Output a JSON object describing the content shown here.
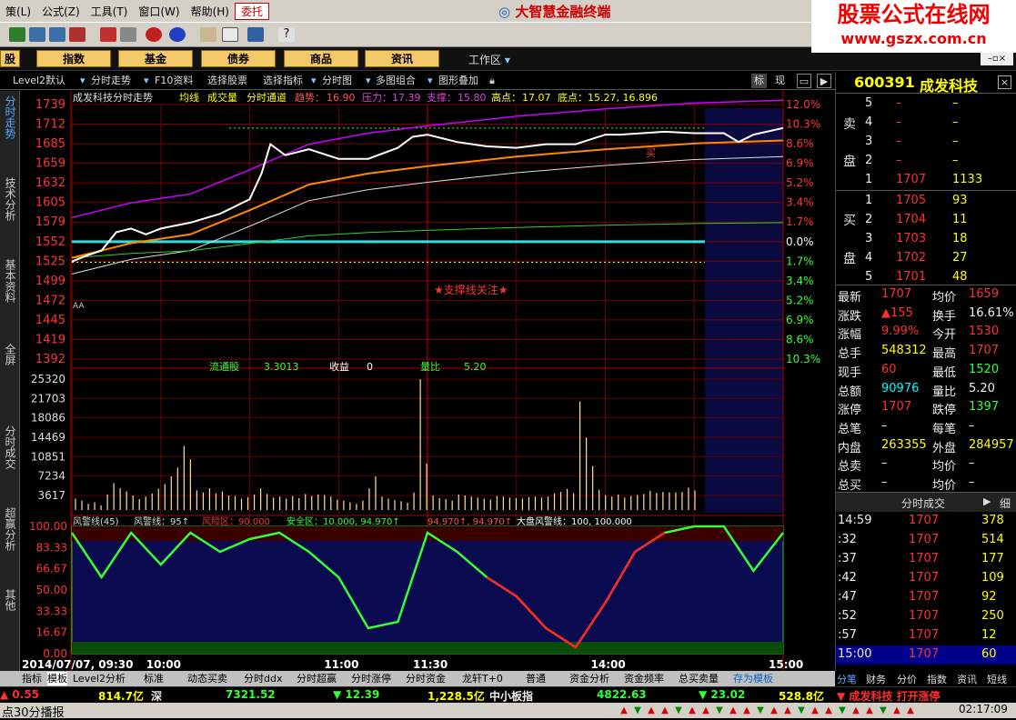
{
  "menu": {
    "items": [
      "策(L)",
      "公式(Z)",
      "工具(T)",
      "窗口(W)",
      "帮助(H)",
      "委托"
    ],
    "brand": "大智慧金融终端"
  },
  "watermark": {
    "line1": "股票公式在线网",
    "line2": "www.gszx.com.cn"
  },
  "nav": {
    "b0": "股",
    "b1": "指数",
    "b2": "基金",
    "b3": "债券",
    "b4": "商品",
    "b5": "资讯",
    "workarea": "工作区"
  },
  "tabs": {
    "t1": "Level2默认",
    "t2": "分时走势",
    "t3": "F10资料",
    "t4": "选择股票",
    "t5": "选择指标",
    "t6": "分时图",
    "t7": "多图组合",
    "t8": "图形叠加",
    "t9": "标",
    "t10": "现"
  },
  "sidebar": [
    "分时走势",
    "技术分析",
    "基本资料",
    "全屏",
    "分时成交",
    "超赢分析",
    "其他"
  ],
  "chart_header": {
    "name": "成发科技分时走势",
    "avg": "均线",
    "vol": "成交量",
    "channel": "分时通道",
    "trend_l": "趋势：",
    "trend_v": "16.90",
    "press_l": "压力：",
    "press_v": "17.39",
    "sup_l": "支撑：",
    "sup_v": "15.80",
    "high_l": "高点：",
    "high_v": "17.07",
    "low_l": "底点：",
    "low_v": "15.27, 16.896"
  },
  "chart_data": {
    "type": "line",
    "title": "成发科技分时走势",
    "prev_close": 15.52,
    "price_ticks": [
      "1739",
      "1712",
      "1685",
      "1659",
      "1632",
      "1605",
      "1579",
      "1552",
      "1525",
      "1499",
      "1472",
      "1445",
      "1419",
      "1392"
    ],
    "pct_ticks": [
      "12.0%",
      "10.3%",
      "8.6%",
      "6.9%",
      "5.2%",
      "3.4%",
      "1.7%",
      "0.0%",
      "1.7%",
      "3.4%",
      "5.2%",
      "6.9%",
      "8.6%",
      "10.3%"
    ],
    "vol_ticks": [
      "25320",
      "21703",
      "18086",
      "14469",
      "10851",
      "7234",
      "3617"
    ],
    "warn_ticks": [
      "100.00",
      "83.33",
      "66.67",
      "50.00",
      "33.33",
      "16.67",
      "0.00"
    ],
    "time_labels": [
      "2014/07/07, 09:30",
      "10:00",
      "11:00",
      "11:30",
      "14:00",
      "15:00"
    ],
    "price_series": [
      [
        0,
        15.25
      ],
      [
        5,
        15.33
      ],
      [
        10,
        15.4
      ],
      [
        15,
        15.65
      ],
      [
        20,
        15.7
      ],
      [
        25,
        15.62
      ],
      [
        30,
        15.7
      ],
      [
        40,
        15.78
      ],
      [
        50,
        15.9
      ],
      [
        60,
        16.1
      ],
      [
        64,
        16.45
      ],
      [
        67,
        16.85
      ],
      [
        72,
        16.7
      ],
      [
        80,
        16.78
      ],
      [
        90,
        16.65
      ],
      [
        100,
        16.65
      ],
      [
        110,
        16.8
      ],
      [
        115,
        16.95
      ],
      [
        120,
        16.98
      ],
      [
        130,
        16.88
      ],
      [
        140,
        16.82
      ],
      [
        150,
        16.8
      ],
      [
        160,
        16.85
      ],
      [
        170,
        16.85
      ],
      [
        180,
        16.98
      ],
      [
        185,
        16.98
      ],
      [
        200,
        17.02
      ],
      [
        210,
        17.0
      ],
      [
        220,
        17.0
      ],
      [
        225,
        16.88
      ],
      [
        230,
        16.98
      ],
      [
        240,
        17.07
      ]
    ],
    "avg_series": [
      [
        0,
        15.3
      ],
      [
        20,
        15.5
      ],
      [
        40,
        15.62
      ],
      [
        60,
        15.95
      ],
      [
        80,
        16.3
      ],
      [
        100,
        16.45
      ],
      [
        120,
        16.55
      ],
      [
        150,
        16.68
      ],
      [
        180,
        16.78
      ],
      [
        210,
        16.86
      ],
      [
        240,
        16.9
      ]
    ],
    "volumes": [
      2200,
      1800,
      1200,
      1500,
      900,
      3000,
      5200,
      4200,
      3600,
      2800,
      2100,
      2600,
      3200,
      4100,
      5000,
      6500,
      8200,
      12400,
      9800,
      3800,
      3400,
      4200,
      3200,
      3600,
      2800,
      2700,
      2200,
      2500,
      3000,
      4200,
      3100,
      2400,
      2600,
      2200,
      2700,
      2300,
      3100,
      2700,
      3000,
      2900,
      2600,
      2000,
      1800,
      1500,
      1200,
      1800,
      4200,
      6500,
      2600,
      2200,
      1900,
      1700,
      1400,
      3400,
      25300,
      9000,
      2800,
      2300,
      2100,
      1800,
      3000,
      2800,
      2600,
      2400,
      2200,
      2000,
      2700,
      2600,
      2400,
      2300,
      2200,
      2500,
      2600,
      2400,
      2600,
      3200,
      3500,
      4100,
      3200,
      21000,
      14000,
      8500,
      3900,
      2900,
      2600,
      3000,
      2400,
      2700,
      2900,
      3100,
      3700,
      3300,
      3500,
      3400,
      3400,
      3500,
      4300,
      3800
    ],
    "warn_series": [
      [
        0,
        95
      ],
      [
        10,
        60
      ],
      [
        20,
        95
      ],
      [
        30,
        70
      ],
      [
        40,
        95
      ],
      [
        50,
        80
      ],
      [
        60,
        90
      ],
      [
        70,
        95
      ],
      [
        80,
        80
      ],
      [
        90,
        60
      ],
      [
        100,
        20
      ],
      [
        110,
        25
      ],
      [
        120,
        95
      ],
      [
        130,
        80
      ],
      [
        140,
        60
      ],
      [
        150,
        45
      ],
      [
        160,
        20
      ],
      [
        170,
        5
      ],
      [
        180,
        40
      ],
      [
        190,
        80
      ],
      [
        200,
        95
      ],
      [
        210,
        100
      ],
      [
        220,
        100
      ],
      [
        230,
        65
      ],
      [
        240,
        95
      ]
    ],
    "sup_line": 15.52
  },
  "overlay": {
    "guide": "★支撑线关注★",
    "float_l": "流通股",
    "float_v": "3.3013",
    "eps_l": "收益",
    "eps_v": "0",
    "volratio_l": "量比",
    "volratio_v": "5.20",
    "aa": "AA",
    "warn_title": "风警线(45)",
    "warn_val": "风警线：95↑",
    "warn_risk": "风险区：90.000",
    "warn_safe": "安全区：10.000, 94.970↑",
    "warn_x": "94.970↑, 94.970↑",
    "warn_big": "大盘风警线：100, 100.000",
    "buy_mark": "买"
  },
  "stock": {
    "code": "600391",
    "name": "成发科技"
  },
  "orderbook": {
    "sell_l": "卖",
    "sell_l2": "盘",
    "buy_l": "买",
    "buy_l2": "盘",
    "sell": [
      [
        "5",
        "–",
        "–"
      ],
      [
        "4",
        "–",
        "–"
      ],
      [
        "3",
        "–",
        "–"
      ],
      [
        "2",
        "–",
        "–"
      ],
      [
        "1",
        "1707",
        "1133"
      ]
    ],
    "buy": [
      [
        "1",
        "1705",
        "93"
      ],
      [
        "2",
        "1704",
        "11"
      ],
      [
        "3",
        "1703",
        "18"
      ],
      [
        "4",
        "1702",
        "27"
      ],
      [
        "5",
        "1701",
        "48"
      ]
    ]
  },
  "quote": [
    [
      "最新",
      "1707",
      "均价",
      "1659"
    ],
    [
      "涨跌",
      "▲155",
      "换手",
      "16.61%"
    ],
    [
      "涨幅",
      "9.99%",
      "今开",
      "1530"
    ],
    [
      "总手",
      "548312",
      "最高",
      "1707"
    ],
    [
      "现手",
      "60",
      "最低",
      "1520"
    ],
    [
      "总额",
      "90976",
      "量比",
      "5.20"
    ],
    [
      "涨停",
      "1707",
      "跌停",
      "1397"
    ],
    [
      "总笔",
      "–",
      "每笔",
      "–"
    ],
    [
      "内盘",
      "263355",
      "外盘",
      "284957"
    ],
    [
      "总卖",
      "–",
      "均价",
      "–"
    ],
    [
      "总买",
      "–",
      "均价",
      "–"
    ]
  ],
  "trades_hdr": "分时成交",
  "trades_tab": "细",
  "trades": [
    [
      "14:59",
      "1707",
      "378"
    ],
    [
      ":32",
      "1707",
      "514"
    ],
    [
      ":37",
      "1707",
      "177"
    ],
    [
      ":42",
      "1707",
      "109"
    ],
    [
      ":47",
      "1707",
      "92"
    ],
    [
      ":52",
      "1707",
      "250"
    ],
    [
      ":57",
      "1707",
      "12"
    ],
    [
      "15:00",
      "1707",
      "60"
    ]
  ],
  "rp_tabs": [
    "分笔",
    "财务",
    "分价",
    "指数",
    "资讯",
    "短线"
  ],
  "bottom_tabs": [
    "指标",
    "模板",
    "Level2分析",
    "标准",
    "动态买卖",
    "分时ddx",
    "分时超赢",
    "分时涨停",
    "分时资金",
    "龙轩T+0",
    "普通",
    "资金分析",
    "资金频率",
    "总买卖量",
    "存为模板"
  ],
  "ticker": {
    "a": "▲ 0.55",
    "b": "814.7亿",
    "c": "深",
    "d": "7321.52",
    "e": "▼ 12.39",
    "f": "1,228.5亿",
    "g": "中小板指",
    "h": "4822.63",
    "i": "▼ 23.02",
    "j": "528.8亿",
    "k": "▼ 成发科技 打开涨停"
  },
  "status": {
    "left": "点30分播报",
    "time": "02:17:09"
  }
}
